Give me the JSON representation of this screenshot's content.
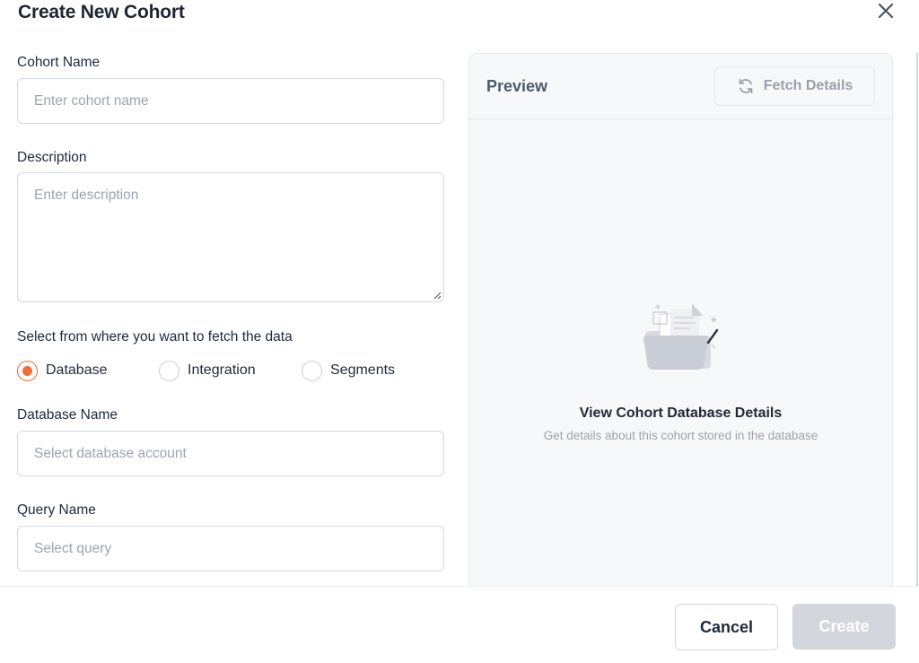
{
  "dialog": {
    "title": "Create New Cohort",
    "close_icon": "close-icon"
  },
  "form": {
    "cohort_name": {
      "label": "Cohort Name",
      "placeholder": "Enter cohort name",
      "value": ""
    },
    "description": {
      "label": "Description",
      "placeholder": "Enter description",
      "value": ""
    },
    "source": {
      "label": "Select from where you want to fetch the data",
      "options": [
        {
          "label": "Database",
          "checked": true
        },
        {
          "label": "Integration",
          "checked": false
        },
        {
          "label": "Segments",
          "checked": false
        }
      ]
    },
    "database_name": {
      "label": "Database Name",
      "placeholder": "Select database account",
      "value": ""
    },
    "query_name": {
      "label": "Query Name",
      "placeholder": "Select query",
      "value": ""
    }
  },
  "preview": {
    "title": "Preview",
    "fetch_label": "Fetch Details",
    "fetch_icon": "refresh-icon",
    "empty_icon": "folder-documents-icon",
    "empty_title": "View Cohort Database Details",
    "empty_subtitle": "Get details about this cohort stored in the database"
  },
  "footer": {
    "cancel_label": "Cancel",
    "create_label": "Create",
    "create_enabled": false
  },
  "colors": {
    "accent": "#f26b3a",
    "create_disabled_bg": "#d3d6dc",
    "panel_bg": "#f7f8fa"
  }
}
